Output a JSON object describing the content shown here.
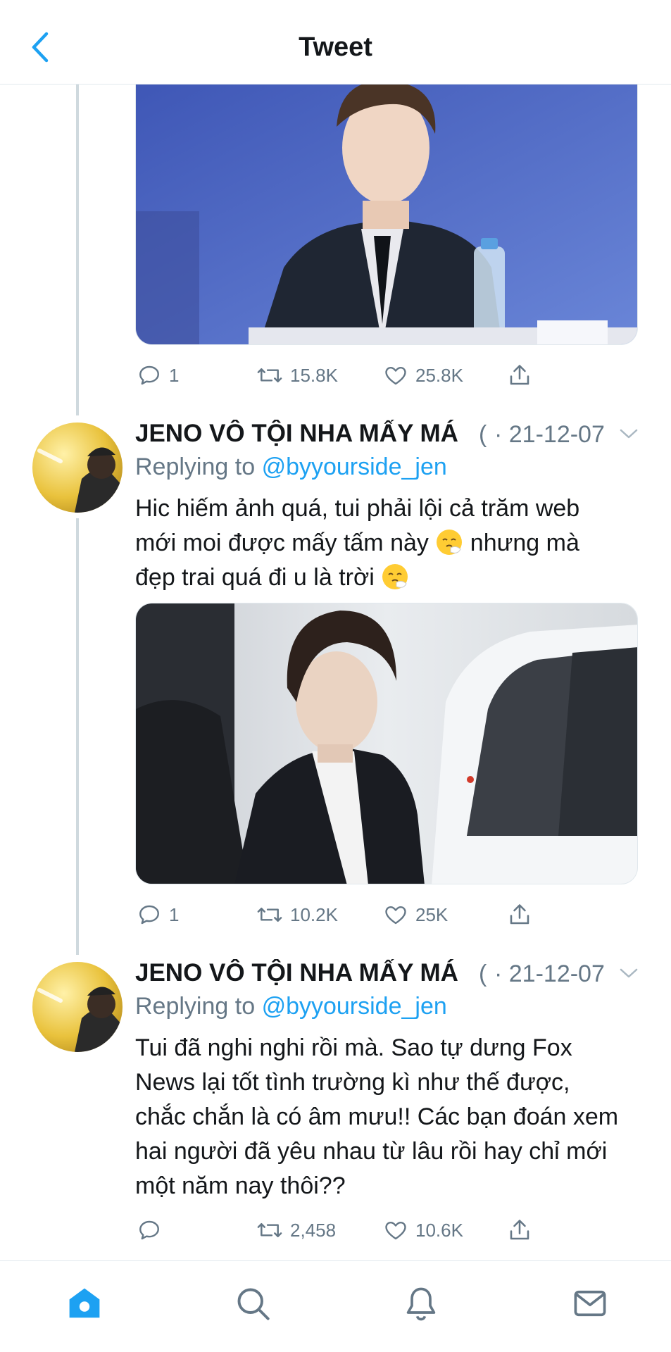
{
  "header": {
    "title": "Tweet"
  },
  "colors": {
    "accent": "#1da1f2",
    "muted": "#657786",
    "divider": "#e1e8ed",
    "thread": "#cfd9de"
  },
  "tweets": [
    {
      "actions": {
        "replies": "1",
        "retweets": "15.8K",
        "likes": "25.8K"
      }
    },
    {
      "name": "JENO VÔ TỘI NHA MẤY MÁ",
      "handle_fragment": "(",
      "date": "· 21-12-07",
      "reply_prefix": "Replying to",
      "reply_handle": "@byyourside_jen",
      "text_line1": "Hic hiếm ảnh quá, tui phải lội cả trăm web",
      "text_line2a": "mới moi được mấy tấm này",
      "text_line2b": "nhưng mà",
      "text_line3": "đẹp trai quá đi u là trời",
      "actions": {
        "replies": "1",
        "retweets": "10.2K",
        "likes": "25K"
      }
    },
    {
      "name": "JENO VÔ TỘI NHA MẤY MÁ",
      "handle_fragment": "(",
      "date": "· 21-12-07",
      "reply_prefix": "Replying to",
      "reply_handle": "@byyourside_jen",
      "text": "Tui đã nghi nghi rồi mà. Sao tự dưng Fox News lại tốt tình trường kì như thế được, chắc chắn là có âm mưu!! Các bạn đoán xem hai người đã yêu nhau từ lâu rồi hay chỉ mới một năm nay thôi??",
      "actions": {
        "replies": "",
        "retweets": "2,458",
        "likes": "10.6K"
      }
    }
  ],
  "nav": {
    "items": [
      "home-icon",
      "search-icon",
      "notifications-icon",
      "messages-icon"
    ]
  }
}
